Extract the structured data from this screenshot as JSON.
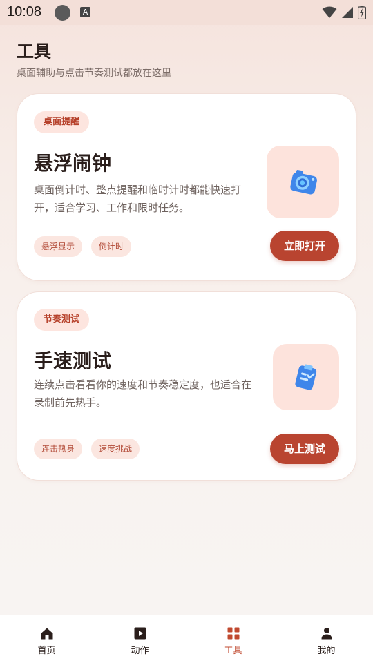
{
  "status_bar": {
    "time": "10:08",
    "badge_letter": "A"
  },
  "header": {
    "title": "工具",
    "subtitle": "桌面辅助与点击节奏测试都放在这里"
  },
  "cards": [
    {
      "chip": "桌面提醒",
      "title": "悬浮闹钟",
      "description": "桌面倒计时、整点提醒和临时计时都能快速打开，适合学习、工作和限时任务。",
      "tags": [
        "悬浮显示",
        "倒计时"
      ],
      "button_label": "立即打开",
      "icon": "camera-icon"
    },
    {
      "chip": "节奏测试",
      "title": "手速测试",
      "description": "连续点击看看你的速度和节奏稳定度，也适合在录制前先热手。",
      "tags": [
        "连击热身",
        "速度挑战"
      ],
      "button_label": "马上测试",
      "icon": "clipboard-check-icon"
    }
  ],
  "bottom_nav": {
    "items": [
      {
        "label": "首页",
        "icon": "home-icon",
        "active": false
      },
      {
        "label": "动作",
        "icon": "play-icon",
        "active": false
      },
      {
        "label": "工具",
        "icon": "grid-icon",
        "active": true
      },
      {
        "label": "我的",
        "icon": "person-icon",
        "active": false
      }
    ]
  },
  "colors": {
    "accent": "#b94430",
    "chip_bg": "#fde5df",
    "active_nav": "#c0492f"
  }
}
